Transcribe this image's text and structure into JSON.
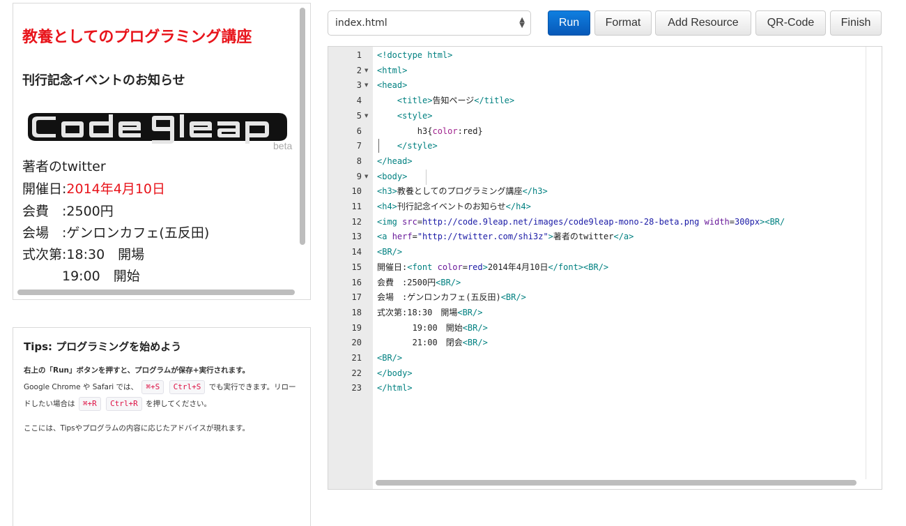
{
  "preview": {
    "h3": "教養としてのプログラミング講座",
    "h4": "刊行記念イベントのお知らせ",
    "logo_text": "Code 9leap",
    "logo_badge": "beta",
    "link": "著者のtwitter",
    "date_label": "開催日:",
    "date_value": "2014年4月10日",
    "fee": "会費　:2500円",
    "venue": "会場　:ゲンロンカフェ(五反田)",
    "schedule1": "式次第:18:30　開場",
    "schedule2": "　　　19:00　開始"
  },
  "tips": {
    "title": "Tips: プログラミングを始めよう",
    "p1_a": "右上の「Run」ボタンを押すと、プログラムが保存+実行されます。",
    "p1_b": "Google Chrome や Safari では、",
    "key1": "⌘+S",
    "key2": "Ctrl+S",
    "p1_c": "でも実行できます。リロードしたい場合は",
    "key3": "⌘+R",
    "key4": "Ctrl+R",
    "p1_d": "を押してください。",
    "p2": "ここには、Tipsやプログラムの内容に応じたアドバイスが現れます。"
  },
  "toolbar": {
    "file": "index.html",
    "run": "Run",
    "format": "Format",
    "add_resource": "Add Resource",
    "qr_code": "QR-Code",
    "finish": "Finish"
  },
  "editor": {
    "line_numbers": [
      "1",
      "2",
      "3",
      "4",
      "5",
      "6",
      "7",
      "8",
      "9",
      "10",
      "11",
      "12",
      "13",
      "14",
      "15",
      "16",
      "17",
      "18",
      "19",
      "20",
      "21",
      "22",
      "23"
    ],
    "folds": [
      2,
      3,
      5,
      9
    ],
    "lines": [
      [
        [
          "tag",
          "<!doctype html>"
        ]
      ],
      [
        [
          "tag",
          "<html>"
        ]
      ],
      [
        [
          "tag",
          "<head>"
        ]
      ],
      [
        [
          "plain",
          "    "
        ],
        [
          "tag",
          "<title>"
        ],
        [
          "plain",
          "告知ページ"
        ],
        [
          "tag",
          "</title>"
        ]
      ],
      [
        [
          "plain",
          "    "
        ],
        [
          "tag",
          "<style>"
        ]
      ],
      [
        [
          "plain",
          "        h3{"
        ],
        [
          "prop",
          "color"
        ],
        [
          "plain",
          ":red}"
        ]
      ],
      [
        [
          "plain",
          "    "
        ],
        [
          "tag",
          "</style>"
        ]
      ],
      [
        [
          "tag",
          "</head>"
        ]
      ],
      [
        [
          "tag",
          "<body>"
        ]
      ],
      [
        [
          "tag",
          "<h3>"
        ],
        [
          "plain",
          "教養としてのプログラミング講座"
        ],
        [
          "tag",
          "</h3>"
        ]
      ],
      [
        [
          "tag",
          "<h4>"
        ],
        [
          "plain",
          "刊行記念イベントのお知らせ"
        ],
        [
          "tag",
          "</h4>"
        ]
      ],
      [
        [
          "tag",
          "<img "
        ],
        [
          "attr",
          "src"
        ],
        [
          "plain",
          "="
        ],
        [
          "str",
          "http://code.9leap.net/images/code9leap-mono-28-beta.png"
        ],
        [
          "plain",
          " "
        ],
        [
          "attr",
          "width"
        ],
        [
          "plain",
          "="
        ],
        [
          "str",
          "300px"
        ],
        [
          "tag",
          ">"
        ],
        [
          "tag",
          "<BR/"
        ]
      ],
      [
        [
          "tag",
          "<a "
        ],
        [
          "attr",
          "herf"
        ],
        [
          "plain",
          "="
        ],
        [
          "str",
          "\"http://twitter.com/shi3z\""
        ],
        [
          "tag",
          ">"
        ],
        [
          "plain",
          "著者のtwitter"
        ],
        [
          "tag",
          "</a>"
        ]
      ],
      [
        [
          "tag",
          "<BR/>"
        ]
      ],
      [
        [
          "plain",
          "開催日:"
        ],
        [
          "tag",
          "<font "
        ],
        [
          "attr",
          "color"
        ],
        [
          "plain",
          "="
        ],
        [
          "str",
          "red"
        ],
        [
          "tag",
          ">"
        ],
        [
          "plain",
          "2014年4月10日"
        ],
        [
          "tag",
          "</font>"
        ],
        [
          "tag",
          "<BR/>"
        ]
      ],
      [
        [
          "plain",
          "会費　:2500円"
        ],
        [
          "tag",
          "<BR/>"
        ]
      ],
      [
        [
          "plain",
          "会場　:ゲンロンカフェ(五反田)"
        ],
        [
          "tag",
          "<BR/>"
        ]
      ],
      [
        [
          "plain",
          "式次第:18:30　開場"
        ],
        [
          "tag",
          "<BR/>"
        ]
      ],
      [
        [
          "plain",
          "       19:00　開始"
        ],
        [
          "tag",
          "<BR/>"
        ]
      ],
      [
        [
          "plain",
          "       21:00　閉会"
        ],
        [
          "tag",
          "<BR/>"
        ]
      ],
      [
        [
          "tag",
          "<BR/>"
        ]
      ],
      [
        [
          "tag",
          "</body>"
        ]
      ],
      [
        [
          "tag",
          "</html>"
        ]
      ]
    ]
  }
}
